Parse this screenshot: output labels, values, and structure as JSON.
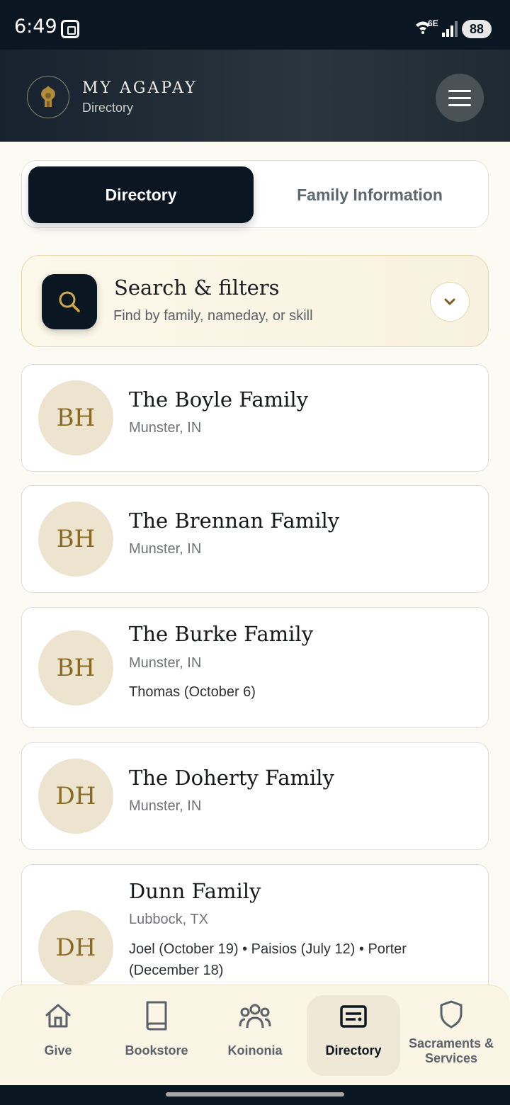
{
  "status_bar": {
    "time": "6:49",
    "network": "6E",
    "battery": "88"
  },
  "header": {
    "brand": "MY AGAPAY",
    "subtitle": "Directory"
  },
  "tabs": [
    {
      "label": "Directory",
      "active": true
    },
    {
      "label": "Family Information",
      "active": false
    }
  ],
  "search": {
    "title": "Search & filters",
    "subtitle": "Find by family, nameday, or skill"
  },
  "families": [
    {
      "initials": "BH",
      "name": "The Boyle Family",
      "location": "Munster, IN",
      "namedays": ""
    },
    {
      "initials": "BH",
      "name": "The Brennan Family",
      "location": "Munster, IN",
      "namedays": ""
    },
    {
      "initials": "BH",
      "name": "The Burke Family",
      "location": "Munster, IN",
      "namedays": "Thomas (October 6)"
    },
    {
      "initials": "DH",
      "name": "The Doherty Family",
      "location": "Munster, IN",
      "namedays": ""
    },
    {
      "initials": "DH",
      "name": "Dunn Family",
      "location": "Lubbock, TX",
      "namedays": "Joel (October 19) • Paisios (July 12) • Porter (December 18)"
    }
  ],
  "nav": [
    {
      "label": "Give",
      "icon": "home-icon",
      "active": false
    },
    {
      "label": "Bookstore",
      "icon": "book-icon",
      "active": false
    },
    {
      "label": "Koinonia",
      "icon": "people-icon",
      "active": false
    },
    {
      "label": "Directory",
      "icon": "directory-icon",
      "active": true
    },
    {
      "label": "Sacraments & Services",
      "icon": "shield-icon",
      "active": false
    }
  ],
  "colors": {
    "primary": "#0b1623",
    "accent": "#8a6a22",
    "avatar_bg": "#ede4cf",
    "background": "#fbfaf3"
  }
}
